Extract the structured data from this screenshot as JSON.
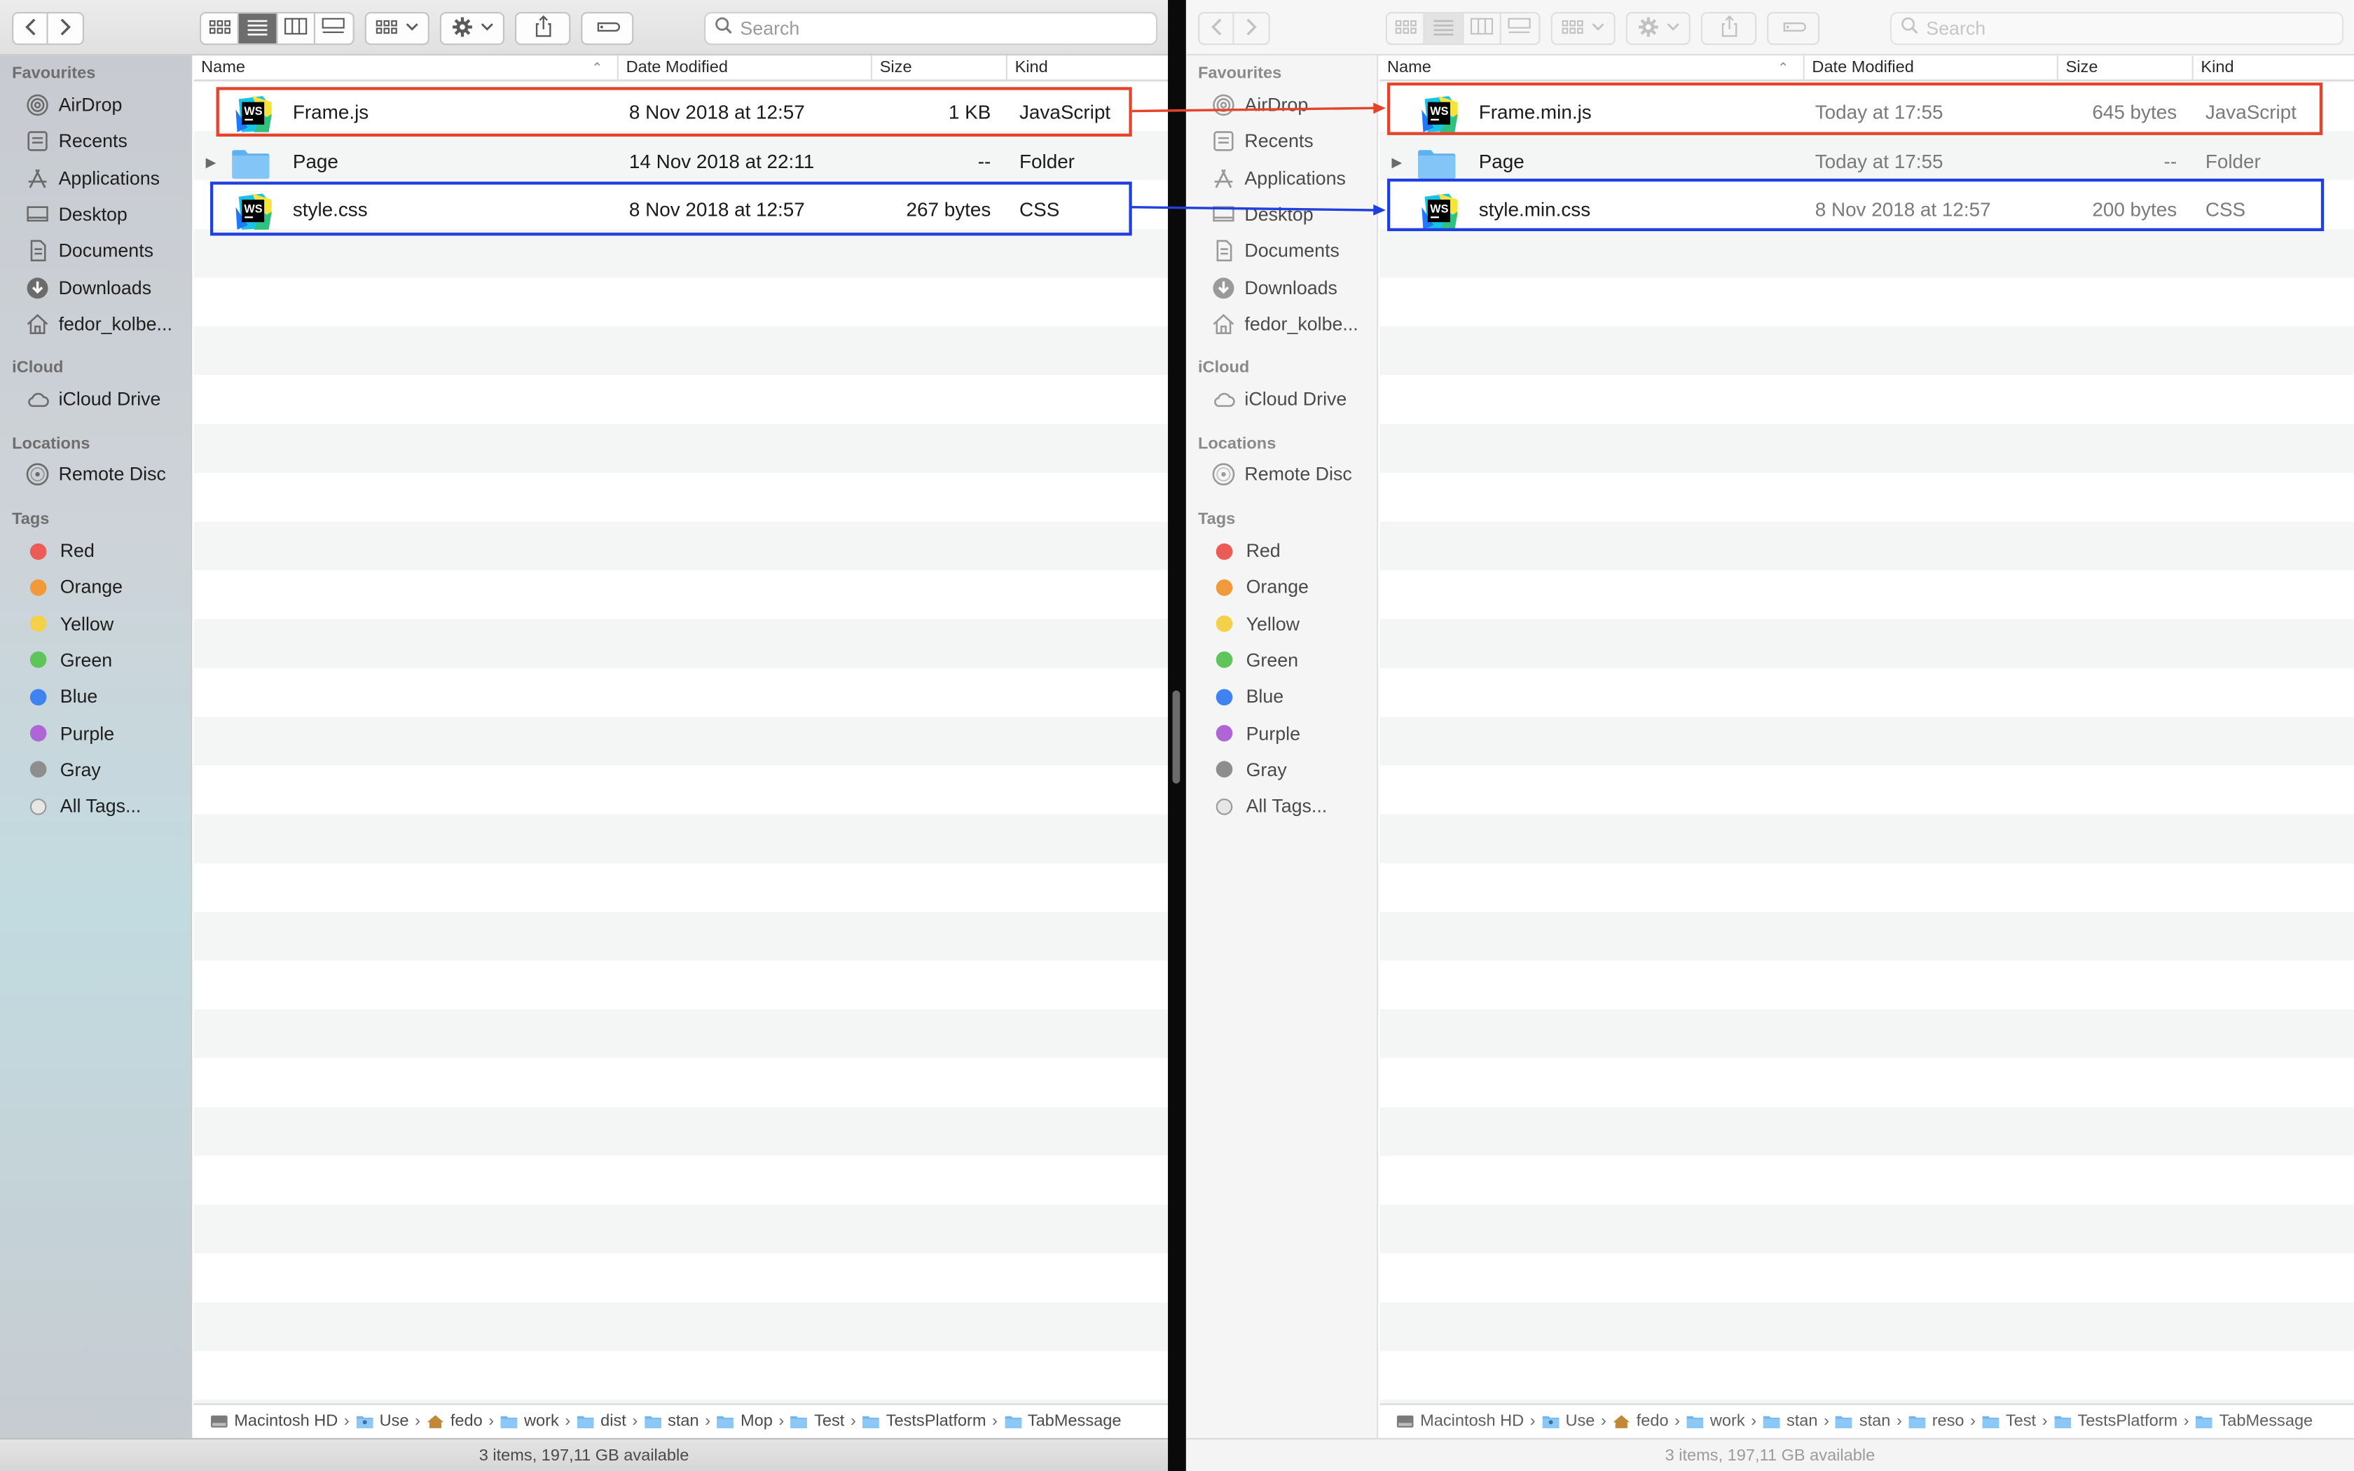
{
  "toolbar": {
    "search_placeholder": "Search"
  },
  "sidebar": {
    "favourites_heading": "Favourites",
    "favourites": [
      {
        "label": "AirDrop",
        "icon": "airdrop-icon"
      },
      {
        "label": "Recents",
        "icon": "recents-icon"
      },
      {
        "label": "Applications",
        "icon": "applications-icon"
      },
      {
        "label": "Desktop",
        "icon": "desktop-icon"
      },
      {
        "label": "Documents",
        "icon": "documents-icon"
      },
      {
        "label": "Downloads",
        "icon": "downloads-icon"
      },
      {
        "label": "fedor_kolbe...",
        "icon": "home-icon"
      }
    ],
    "icloud_heading": "iCloud",
    "icloud_drive": "iCloud Drive",
    "locations_heading": "Locations",
    "remote_disc": "Remote Disc",
    "tags_heading": "Tags",
    "tags": [
      {
        "label": "Red",
        "color": "#ec5b56"
      },
      {
        "label": "Orange",
        "color": "#f19a3b"
      },
      {
        "label": "Yellow",
        "color": "#f4d04b"
      },
      {
        "label": "Green",
        "color": "#5fc45a"
      },
      {
        "label": "Blue",
        "color": "#3f83f2"
      },
      {
        "label": "Purple",
        "color": "#b065d6"
      },
      {
        "label": "Gray",
        "color": "#8e8e8e"
      },
      {
        "label": "All Tags...",
        "color": ""
      }
    ]
  },
  "columns": {
    "name": "Name",
    "date": "Date Modified",
    "size": "Size",
    "kind": "Kind"
  },
  "left": {
    "files": [
      {
        "name": "Frame.js",
        "date": "8 Nov 2018 at 12:57",
        "size": "1 KB",
        "kind": "JavaScript",
        "type": "ws"
      },
      {
        "name": "Page",
        "date": "14 Nov 2018 at 22:11",
        "size": "--",
        "kind": "Folder",
        "type": "folder"
      },
      {
        "name": "style.css",
        "date": "8 Nov 2018 at 12:57",
        "size": "267 bytes",
        "kind": "CSS",
        "type": "ws"
      }
    ],
    "status": "3 items, 197,11 GB available"
  },
  "right": {
    "files": [
      {
        "name": "Frame.min.js",
        "date": "Today at 17:55",
        "size": "645 bytes",
        "kind": "JavaScript",
        "type": "ws"
      },
      {
        "name": "Page",
        "date": "Today at 17:55",
        "size": "--",
        "kind": "Folder",
        "type": "folder"
      },
      {
        "name": "style.min.css",
        "date": "8 Nov 2018 at 12:57",
        "size": "200 bytes",
        "kind": "CSS",
        "type": "ws"
      }
    ],
    "status": "3 items, 197,11 GB available"
  },
  "pathbar_left": [
    "Macintosh HD",
    "Use",
    "fedo",
    "work",
    "dist",
    "stan",
    "Mop",
    "Test",
    "TestsPlatform",
    "TabMessage"
  ],
  "pathbar_right": [
    "Macintosh HD",
    "Use",
    "fedo",
    "work",
    "stan",
    "stan",
    "reso",
    "Test",
    "TestsPlatform",
    "TabMessage"
  ],
  "highlight_colors": {
    "js": "#e5442b",
    "css": "#1f3fe0"
  }
}
